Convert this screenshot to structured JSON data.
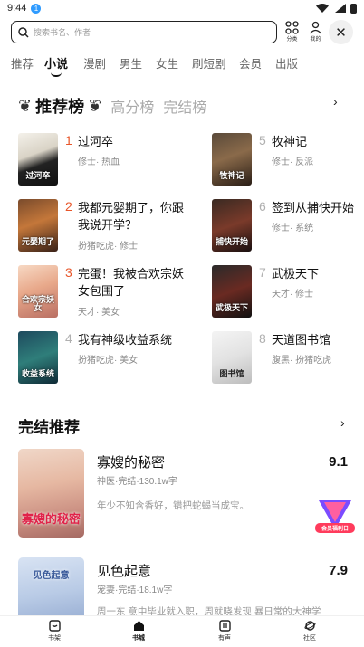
{
  "status": {
    "time": "9:44",
    "badge": "1"
  },
  "search": {
    "placeholder": "搜索书名、作者"
  },
  "top_icons": [
    {
      "label": "分类"
    },
    {
      "label": "我的"
    }
  ],
  "tabs": [
    "推荐",
    "小说",
    "漫剧",
    "男生",
    "女生",
    "刷短剧",
    "会员",
    "出版"
  ],
  "active_tab": "小说",
  "ranking": {
    "title": "推荐榜",
    "other_tabs": [
      "高分榜",
      "完结榜"
    ],
    "books": [
      {
        "rank": "1",
        "title": "过河卒",
        "tags": "修士· 热血",
        "cover_text": "过河卒"
      },
      {
        "rank": "2",
        "title": "我都元婴期了，你跟我说开学？",
        "tags": "扮猪吃虎· 修士",
        "cover_text": "元婴期了"
      },
      {
        "rank": "3",
        "title": "完蛋！我被合欢宗妖女包围了",
        "tags": "天才· 美女",
        "cover_text": "合欢宗妖女"
      },
      {
        "rank": "4",
        "title": "我有神级收益系统",
        "tags": "扮猪吃虎· 美女",
        "cover_text": "收益系统"
      },
      {
        "rank": "5",
        "title": "牧神记",
        "tags": "修士· 反派",
        "cover_text": "牧神记"
      },
      {
        "rank": "6",
        "title": "签到从捕快开始",
        "tags": "修士· 系统",
        "cover_text": "捕快开始"
      },
      {
        "rank": "7",
        "title": "武极天下",
        "tags": "天才· 修士",
        "cover_text": "武极天下"
      },
      {
        "rank": "8",
        "title": "天道图书馆",
        "tags": "腹黑· 扮猪吃虎",
        "cover_text": "图书馆"
      }
    ]
  },
  "finished": {
    "title": "完结推荐",
    "books": [
      {
        "title": "寡嫂的秘密",
        "meta": "神医·完结·130.1w字",
        "desc": "年少不知含香好，错把蛇蝎当成宝。",
        "score": "9.1",
        "cover_text": "寡嫂的秘密"
      },
      {
        "title": "见色起意",
        "meta": "宠妻·完结·18.1w字",
        "desc": "周一东 意中毕业就入职，周就晓发现 暴日常的大神学",
        "score": "7.9",
        "cover_text": "见色起意"
      }
    ]
  },
  "promo": {
    "label": "会员福利日"
  },
  "bottom_nav": [
    {
      "label": "书架"
    },
    {
      "label": "书城"
    },
    {
      "label": "有声"
    },
    {
      "label": "社区"
    }
  ],
  "colors": {
    "accent_rank": "#e8562a",
    "muted_rank": "#b0b0b0"
  }
}
